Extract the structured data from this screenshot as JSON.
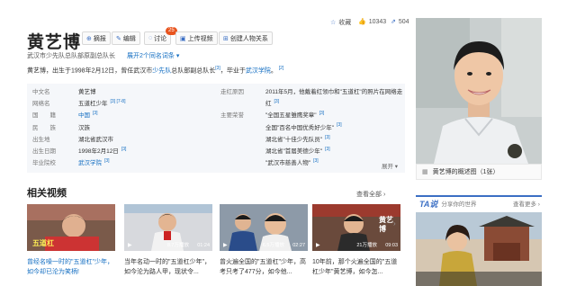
{
  "header": {
    "title": "黄艺博",
    "buttons": [
      {
        "label": "摘报",
        "icon": "report-icon"
      },
      {
        "label": "编辑",
        "icon": "edit-icon"
      },
      {
        "label": "讨论",
        "icon": "discuss-icon"
      },
      {
        "label": "上传视频",
        "icon": "video-upload-icon"
      },
      {
        "label": "创建人物关系",
        "icon": "relation-icon"
      }
    ],
    "discuss_count": "25",
    "stats": {
      "favorite": "收藏",
      "likes": "10343",
      "shares": "504"
    },
    "subtitle": "武汉市少先队总队部原副总队长",
    "synonym_link": "展开2个同名词条"
  },
  "intro": {
    "part1": "黄艺博，出生于1998年2月12日，曾任武汉市",
    "link1": "少先队",
    "part2": "总队部副总队长",
    "ref1": "[3]",
    "part3": "，毕业于",
    "link2": "武汉学院",
    "part4": "。",
    "ref2": "[2]"
  },
  "infobox": {
    "left": [
      {
        "label": "中文名",
        "value": "黄艺博",
        "ref": ""
      },
      {
        "label": "网络名",
        "value": "五道杠少年",
        "ref": "[3] [7-8]"
      },
      {
        "label": "国　　籍",
        "value": "中国",
        "ref": "[3]",
        "link": true
      },
      {
        "label": "民　　族",
        "value": "汉族",
        "ref": ""
      },
      {
        "label": "出生地",
        "value": "湖北省武汉市",
        "ref": ""
      },
      {
        "label": "出生日期",
        "value": "1998年2月12日",
        "ref": "[3]"
      },
      {
        "label": "毕业院校",
        "value": "武汉学院",
        "ref": "[3]",
        "link": true
      }
    ],
    "right_labels": [
      {
        "label": "走红原因",
        "row": 0
      },
      {
        "label": "主要荣誉",
        "row": 2
      }
    ],
    "right_values": [
      {
        "value": "2011年5月，他戴着红领巾和\"五道杠\"的照片在网络走",
        "ref": ""
      },
      {
        "value": "红",
        "ref": "[3]"
      },
      {
        "value": "\"全国五星雏鹰奖章\"",
        "ref": "[3]"
      },
      {
        "value": "全国\"百名中国优秀好少年\"",
        "ref": "[3]"
      },
      {
        "value": "湖北省\"十佳少先队员\"",
        "ref": "[3]"
      },
      {
        "value": "湖北省\"首届美德少年\"",
        "ref": "[3]"
      },
      {
        "value": "\"武汉市慈善人物\"",
        "ref": "[3]"
      }
    ],
    "expand": "展开"
  },
  "photo": {
    "caption": "黄艺博的概述图（1张）"
  },
  "related": {
    "title": "相关视频",
    "view_all": "查看全部",
    "videos": [
      {
        "plays": "",
        "duration": "",
        "title": "曾经名噪一时的\"五道杠\"少年，如今却已沦为笑柄!",
        "highlight": true
      },
      {
        "plays": "8.7万播放",
        "duration": "01:24",
        "title": "当年名动一时的\"五道杠少年\"，如今沦为路人甲，现状令..."
      },
      {
        "plays": "6.5万播放",
        "duration": "02:27",
        "title": "曾火遍全国的\"五道杠\"少年，高考只考了477分，如今他..."
      },
      {
        "plays": "21万播放",
        "duration": "09:03",
        "title": "10年前，那个火遍全国的\"五道杠少年\"黄艺博，如今怎..."
      }
    ]
  },
  "ta": {
    "logo": "TA说",
    "subtitle": "分享你的世界",
    "more": "查看更多"
  },
  "colors": {
    "accent": "#136ec2",
    "badge": "#e8541e",
    "infobox_bg": "#f5f7fa"
  }
}
